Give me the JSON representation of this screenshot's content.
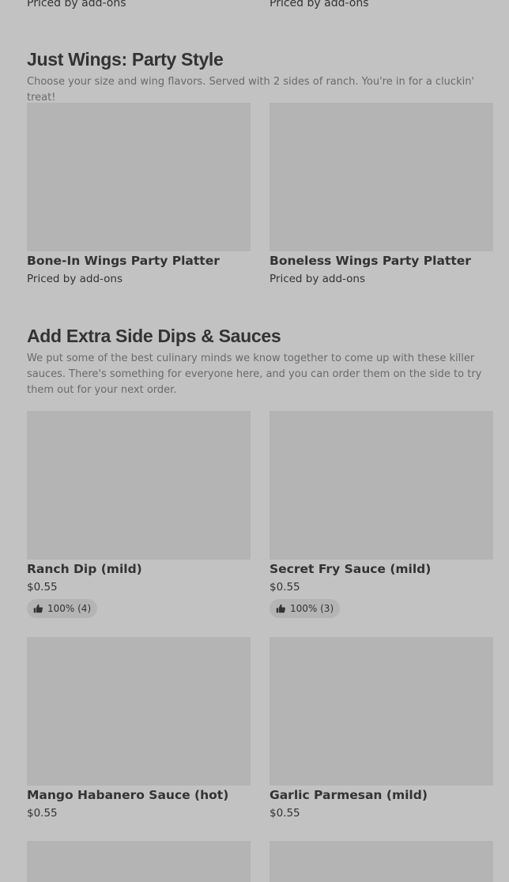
{
  "top_row": {
    "left_price": "Priced by add-ons",
    "right_price": "Priced by add-ons"
  },
  "sections": [
    {
      "title": "Just Wings: Party Style",
      "description": "Choose your size and wing flavors. Served with 2 sides of ranch. You're in for a cluckin' treat!",
      "items": [
        {
          "name": "Bone-In Wings Party Platter",
          "price": "Priced by add-ons"
        },
        {
          "name": "Boneless Wings Party Platter",
          "price": "Priced by add-ons"
        }
      ]
    },
    {
      "title": "Add Extra Side Dips & Sauces",
      "description": "We put some of the best culinary minds we know together to come up with these killer sauces. There's something for everyone here, and you can order them on the side to try them out for your next order.",
      "items": [
        {
          "name": "Ranch Dip (mild)",
          "price": "$0.55",
          "rating": "100% (4)"
        },
        {
          "name": "Secret Fry Sauce (mild)",
          "price": "$0.55",
          "rating": "100% (3)"
        },
        {
          "name": "Mango Habanero Sauce (hot)",
          "price": "$0.55"
        },
        {
          "name": "Garlic Parmesan (mild)",
          "price": "$0.55"
        }
      ]
    }
  ],
  "icons": {
    "rating": "thumbs-up-icon"
  },
  "colors": {
    "background": "#c2c2c2",
    "image_placeholder": "#b4b4b4"
  }
}
